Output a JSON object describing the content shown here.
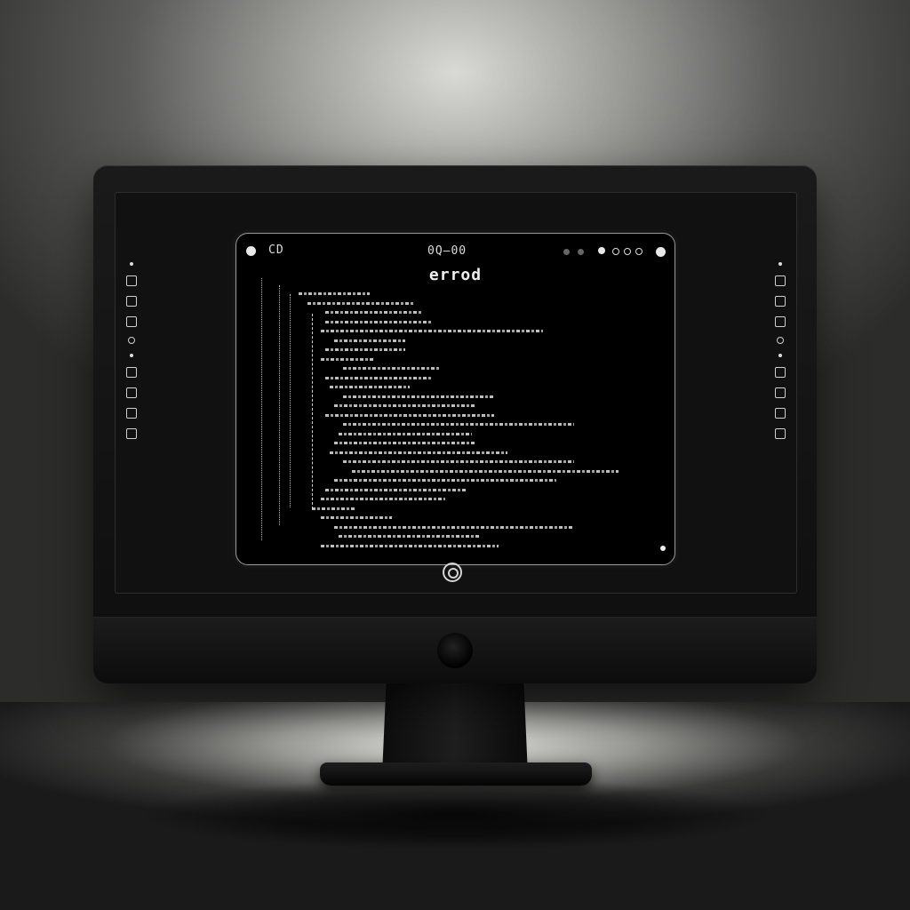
{
  "window": {
    "title": "errod",
    "left_glyph": "CD",
    "center_glyph": "0Q—00"
  },
  "icons": {
    "traffic_dot": "window-control-icon",
    "home": "home-button-icon",
    "camera": "camera-icon"
  },
  "colors": {
    "bezel": "#111111",
    "window_bg": "#000000",
    "text": "#e0e0e0"
  }
}
